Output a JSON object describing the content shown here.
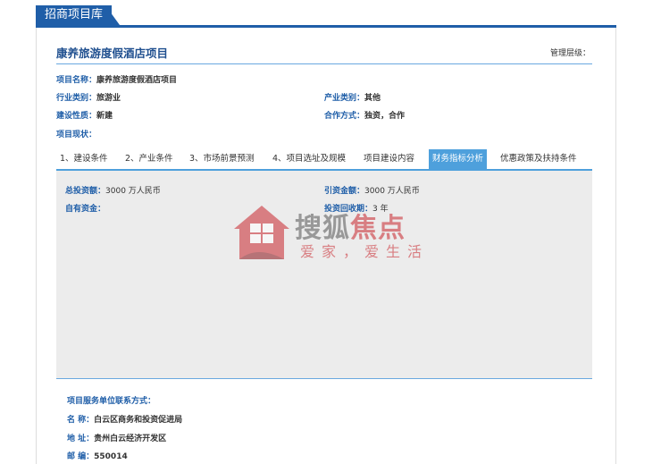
{
  "header": {
    "title": "招商项目库"
  },
  "project": {
    "title": "康养旅游度假酒店项目",
    "mgmt_label": "管理层级："
  },
  "info": {
    "name_label": "项目名称：",
    "name_value": "康养旅游度假酒店项目",
    "industry_label": "行业类别：",
    "industry_value": "旅游业",
    "product_label": "产业类别：",
    "product_value": "其他",
    "nature_label": "建设性质：",
    "nature_value": "新建",
    "coop_label": "合作方式：",
    "coop_value": "独资，合作",
    "status_label": "项目现状：",
    "status_value": ""
  },
  "tabs": [
    {
      "label": "1、建设条件"
    },
    {
      "label": "2、产业条件"
    },
    {
      "label": "3、市场前景预测"
    },
    {
      "label": "4、项目选址及规模"
    },
    {
      "label": "项目建设内容"
    },
    {
      "label": "财务指标分析"
    },
    {
      "label": "优惠政策及扶持条件"
    }
  ],
  "finance": {
    "total_label": "总投资额：",
    "total_value": "3000 万人民币",
    "attract_label": "引资金额：",
    "attract_value": "3000 万人民币",
    "own_label": "自有资金：",
    "own_value": "",
    "payback_label": "投资回收期：",
    "payback_value": "3 年"
  },
  "watermark": {
    "brand_a": "搜狐",
    "brand_b": "焦点",
    "slogan": "爱家，爱生活"
  },
  "contact": {
    "heading": "项目服务单位联系方式：",
    "name_label": "名  称：",
    "name_value": "白云区商务和投资促进局",
    "addr_label": "地  址：",
    "addr_value": "贵州白云经济开发区",
    "zip_label": "邮  编：",
    "zip_value": "550014"
  },
  "colors": {
    "brand_blue": "#1f5ea8",
    "tab_active": "#4ea0dc",
    "watermark_red": "#c9252c"
  }
}
